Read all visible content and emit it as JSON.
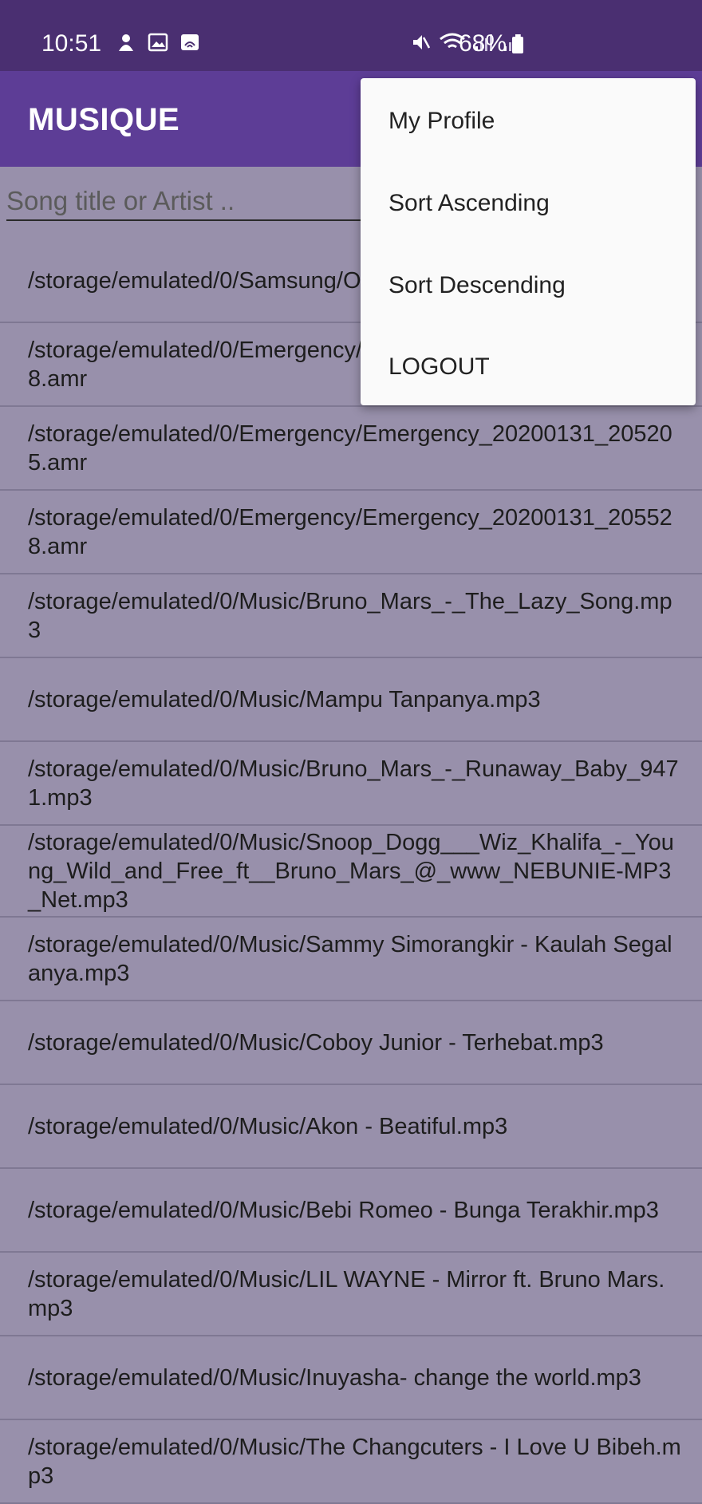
{
  "status_bar": {
    "time": "10:51",
    "battery": "68%",
    "left_icons": [
      "notification-icon",
      "image-icon",
      "cast-icon"
    ],
    "right_icons": [
      "mute-icon",
      "wifi-icon",
      "signal-icon",
      "signal-icon",
      "battery-icon"
    ]
  },
  "app_bar": {
    "title": "MUSIQUE"
  },
  "search": {
    "placeholder": "Song title or Artist .."
  },
  "songs": [
    "/storage/emulated/0/Samsung/Over_the_Horizon.mp3",
    "/storage/emulated/0/Emergency/Emergency_20200131_204958.amr",
    "/storage/emulated/0/Emergency/Emergency_20200131_205205.amr",
    "/storage/emulated/0/Emergency/Emergency_20200131_205528.amr",
    "/storage/emulated/0/Music/Bruno_Mars_-_The_Lazy_Song.mp3",
    "/storage/emulated/0/Music/Mampu Tanpanya.mp3",
    "/storage/emulated/0/Music/Bruno_Mars_-_Runaway_Baby_9471.mp3",
    "/storage/emulated/0/Music/Snoop_Dogg___Wiz_Khalifa_-_Young_Wild_and_Free_ft__Bruno_Mars_@_www_NEBUNIE-MP3_Net.mp3",
    "/storage/emulated/0/Music/Sammy Simorangkir - Kaulah Segalanya.mp3",
    "/storage/emulated/0/Music/Coboy Junior - Terhebat.mp3",
    "/storage/emulated/0/Music/Akon - Beatiful.mp3",
    "/storage/emulated/0/Music/Bebi Romeo - Bunga Terakhir.mp3",
    "/storage/emulated/0/Music/LIL WAYNE - Mirror ft. Bruno Mars.mp3",
    "/storage/emulated/0/Music/Inuyasha- change the world.mp3",
    "/storage/emulated/0/Music/The Changcuters - I Love U Bibeh.mp3"
  ],
  "menu": {
    "items": [
      "My Profile",
      "Sort Ascending",
      "Sort Descending",
      "LOGOUT"
    ]
  },
  "colors": {
    "status_bar": "#4a2f71",
    "app_bar": "#5d3d96",
    "list_background": "#9890ab",
    "menu_background": "#fafafa"
  }
}
